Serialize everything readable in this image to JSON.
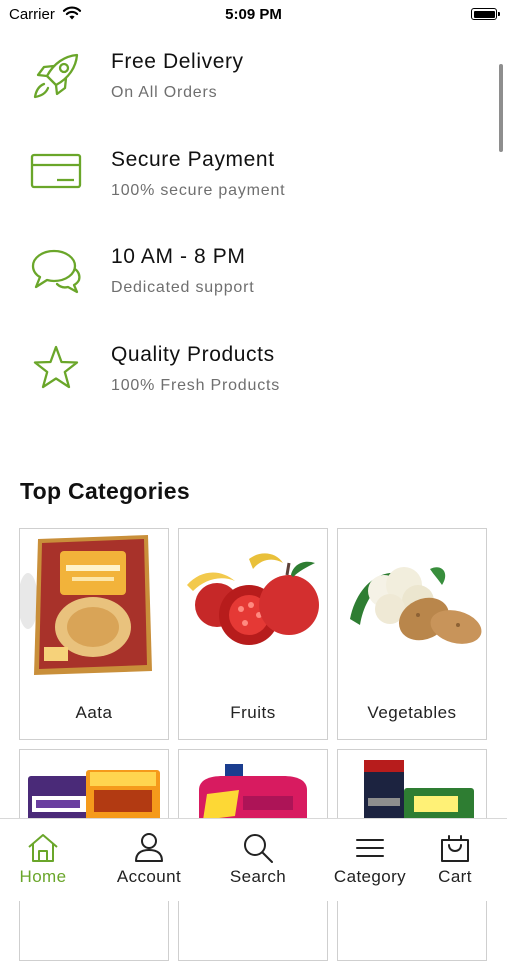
{
  "status_bar": {
    "carrier": "Carrier",
    "time": "5:09 PM"
  },
  "colors": {
    "accent": "#6aa62a",
    "text": "#111111",
    "muted": "#6f6f6f",
    "border": "#cfcfcf"
  },
  "features": [
    {
      "icon": "rocket-icon",
      "title": "Free Delivery",
      "subtitle": "On All Orders"
    },
    {
      "icon": "credit-card-icon",
      "title": "Secure Payment",
      "subtitle": "100% secure payment"
    },
    {
      "icon": "chat-bubbles-icon",
      "title": "10 AM - 8 PM",
      "subtitle": "Dedicated support"
    },
    {
      "icon": "star-icon",
      "title": "Quality Products",
      "subtitle": "100% Fresh Products"
    }
  ],
  "top_categories": {
    "title": "Top Categories",
    "items": [
      {
        "name": "Aata"
      },
      {
        "name": "Fruits"
      },
      {
        "name": "Vegetables"
      },
      {
        "name": ""
      },
      {
        "name": ""
      },
      {
        "name": ""
      }
    ]
  },
  "bottom_nav": [
    {
      "label": "Home",
      "icon": "home-icon",
      "active": true
    },
    {
      "label": "Account",
      "icon": "user-icon",
      "active": false
    },
    {
      "label": "Search",
      "icon": "search-icon",
      "active": false
    },
    {
      "label": "Category",
      "icon": "menu-icon",
      "active": false
    },
    {
      "label": "Cart",
      "icon": "shopping-bag-icon",
      "active": false
    }
  ]
}
